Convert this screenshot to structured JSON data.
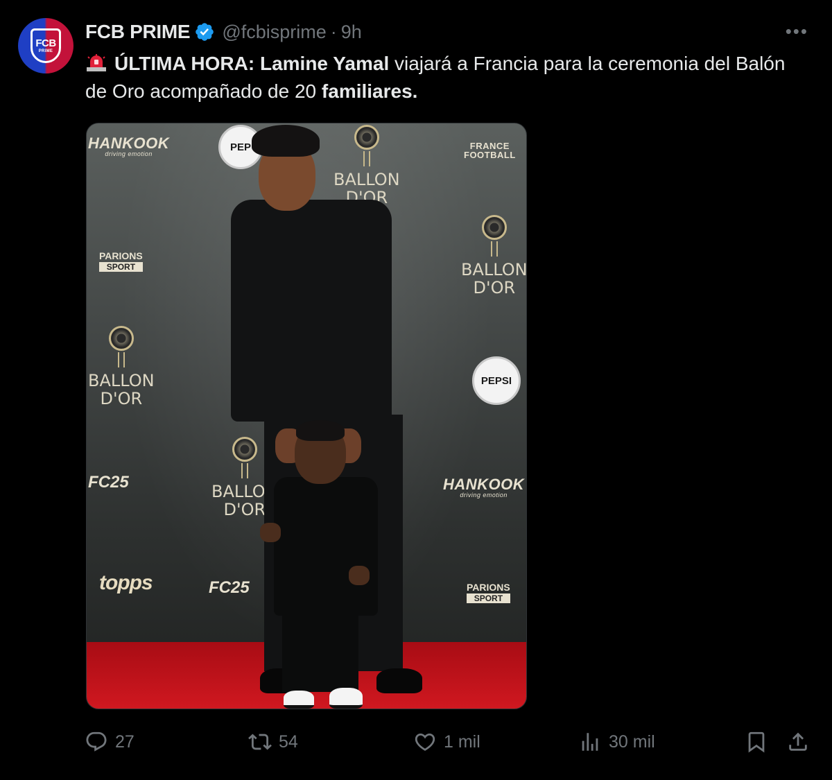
{
  "author": {
    "display_name": "FCB PRIME",
    "handle": "@fcbisprime",
    "separator": "·",
    "time": "9h",
    "verified": true,
    "avatar_text_main": "FCB",
    "avatar_text_sub": "PRIME"
  },
  "more_menu": "•••",
  "tweet": {
    "emoji": "siren-icon",
    "part1_bold": "ÚLTIMA HORA:",
    "part2_bold": "Lamine Yamal",
    "part3": "viajará a Francia para la ceremonia del Balón de Oro acompañado de 20",
    "part4_bold": "familiares."
  },
  "photo": {
    "logos": {
      "hankook": "HANKOOK",
      "hankook_tag": "driving emotion",
      "pepsi": "PEPSI",
      "pepsi_partial": "PEP",
      "ballon_line1": "BALLON",
      "ballon_line2": "D'OR",
      "france_football_1": "FRANCE",
      "france_football_2": "FOOTBALL",
      "parions": "PARIONS",
      "sport": "SPORT",
      "fc25": "FC25",
      "topps": "topps"
    }
  },
  "actions": {
    "replies": "27",
    "reposts": "54",
    "likes": "1 mil",
    "views": "30 mil"
  },
  "colors": {
    "background": "#000000",
    "text_primary": "#e7e9ea",
    "text_secondary": "#71767b",
    "verified_blue": "#1d9bf0"
  }
}
